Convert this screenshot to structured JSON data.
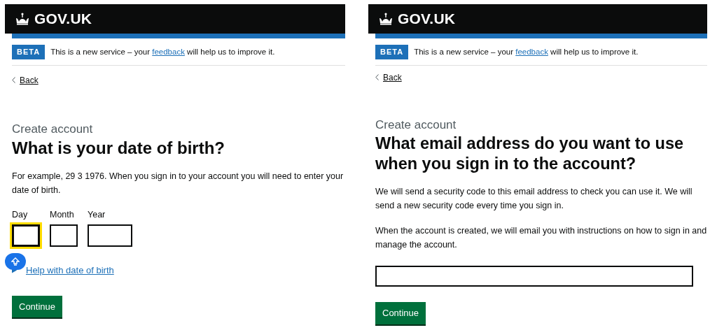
{
  "screens": [
    {
      "kind": "date",
      "logo": "GOV.UK",
      "phase": {
        "tag": "BETA",
        "before": "This is a new service – your",
        "link": "feedback",
        "after": "will help us to improve it."
      },
      "back": "Back",
      "caption": "Create account",
      "heading": "What is your date of birth?",
      "paragraphs": [
        "For example, 29 3 1976. When you sign in to your account you will need to enter your date of birth."
      ],
      "date_fields": [
        {
          "label": "Day",
          "focused": true
        },
        {
          "label": "Month",
          "focused": false
        },
        {
          "label": "Year",
          "focused": false
        }
      ],
      "details": {
        "summary": "Help with date of birth",
        "expanded": false
      },
      "button": "Continue"
    },
    {
      "kind": "email",
      "logo": "GOV.UK",
      "phase": {
        "tag": "BETA",
        "before": "This is a new service – your",
        "link": "feedback",
        "after": "will help us to improve it."
      },
      "back": "Back",
      "caption": "Create account",
      "heading": "What email address do you want to use when you sign in to the account?",
      "paragraphs": [
        "We will send a security code to this email address to check you can use it. We will send a new security code every time you sign in.",
        "When the account is created, we will email you with instructions on how to sign in and manage the account."
      ],
      "button": "Continue"
    }
  ]
}
